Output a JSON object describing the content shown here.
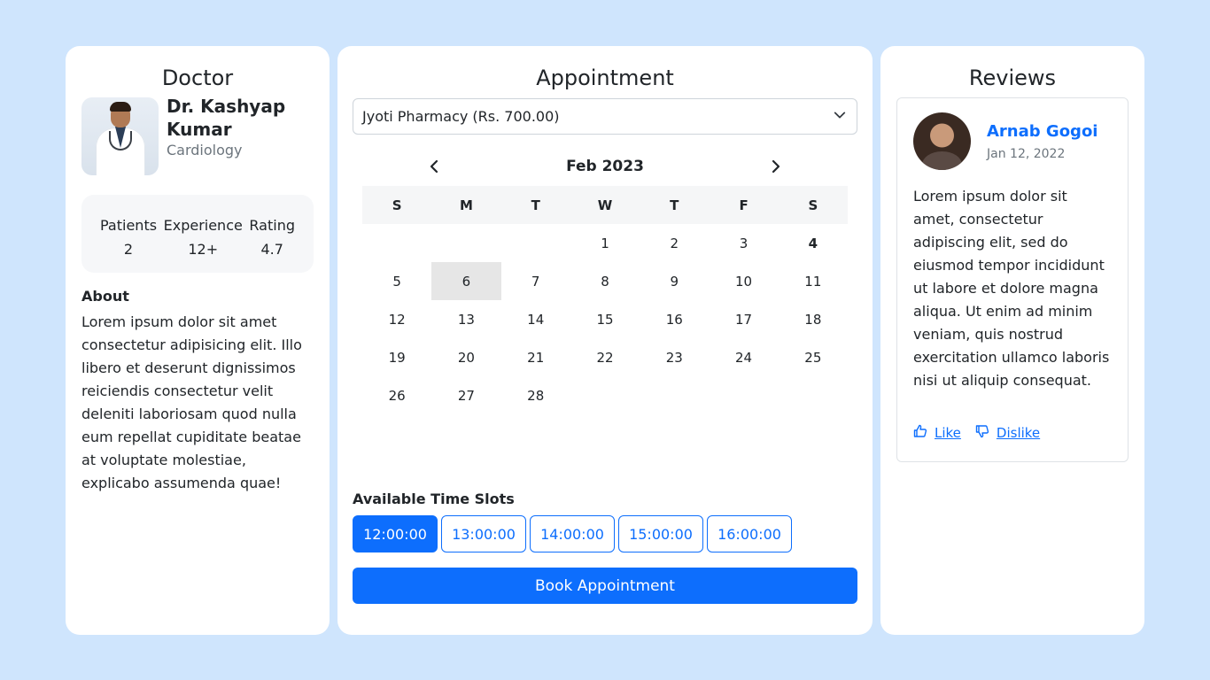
{
  "doctor": {
    "title": "Doctor",
    "name": "Dr. Kashyap Kumar",
    "specialty": "Cardiology",
    "stats": [
      {
        "label": "Patients",
        "value": "2"
      },
      {
        "label": "Experience",
        "value": "12+"
      },
      {
        "label": "Rating",
        "value": "4.7"
      }
    ],
    "about_heading": "About",
    "about_text": "Lorem ipsum dolor sit amet consectetur adipisicing elit. Illo libero et deserunt dignissimos reiciendis consectetur velit deleniti laboriosam quod nulla eum repellat cupiditate beatae at voluptate molestiae, explicabo assumenda quae!"
  },
  "appointment": {
    "title": "Appointment",
    "pharmacy_selected": "Jyoti Pharmacy (Rs. 700.00)",
    "calendar": {
      "month": "Feb 2023",
      "weekdays": [
        "S",
        "M",
        "T",
        "W",
        "T",
        "F",
        "S"
      ],
      "weeks": [
        [
          "",
          "",
          "",
          "1",
          "2",
          "3",
          "4"
        ],
        [
          "5",
          "6",
          "7",
          "8",
          "9",
          "10",
          "11"
        ],
        [
          "12",
          "13",
          "14",
          "15",
          "16",
          "17",
          "18"
        ],
        [
          "19",
          "20",
          "21",
          "22",
          "23",
          "24",
          "25"
        ],
        [
          "26",
          "27",
          "28",
          "",
          "",
          "",
          ""
        ]
      ],
      "selected_day": "6",
      "bold_day": "4"
    },
    "slots_heading": "Available Time Slots",
    "slots": [
      "12:00:00",
      "13:00:00",
      "14:00:00",
      "15:00:00",
      "16:00:00"
    ],
    "active_slot": "12:00:00",
    "book_label": "Book Appointment"
  },
  "reviews": {
    "title": "Reviews",
    "items": [
      {
        "name": "Arnab Gogoi",
        "date": "Jan 12, 2022",
        "text": "Lorem ipsum dolor sit amet, consectetur adipiscing elit, sed do eiusmod tempor incididunt ut labore et dolore magna aliqua. Ut enim ad minim veniam, quis nostrud exercitation ullamco laboris nisi ut aliquip consequat.",
        "like_label": "Like",
        "dislike_label": "Dislike"
      }
    ]
  },
  "colors": {
    "background": "#cfe5fd",
    "primary": "#0d6efd",
    "muted": "#6c757d"
  }
}
